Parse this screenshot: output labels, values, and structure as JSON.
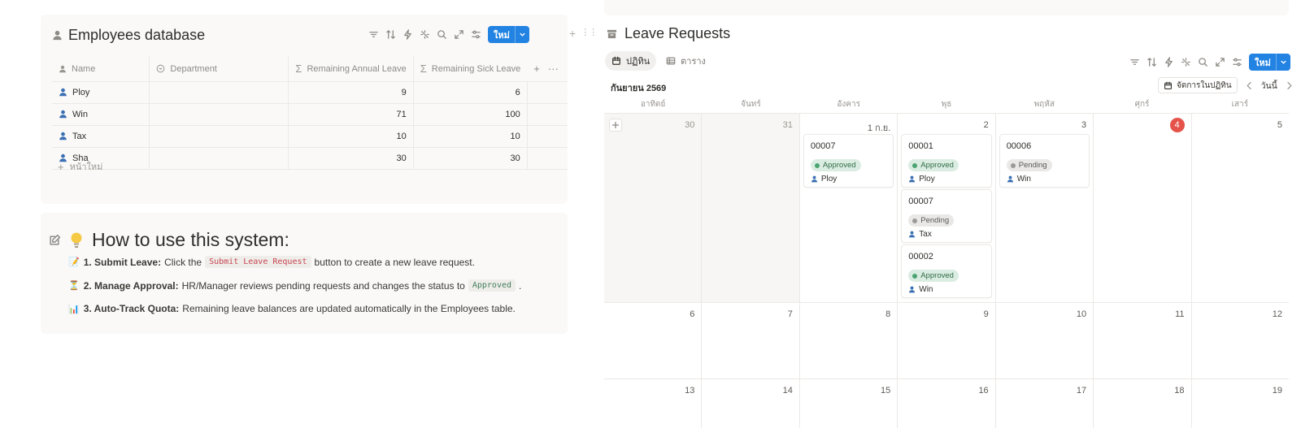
{
  "employees": {
    "title": "Employees database",
    "new_label": "ใหม่",
    "columns": [
      "Name",
      "Department",
      "Remaining Annual Leave",
      "Remaining Sick Leave"
    ],
    "rows": [
      {
        "name": "Ploy",
        "department": "",
        "annual": "9",
        "sick": "6"
      },
      {
        "name": "Win",
        "department": "",
        "annual": "71",
        "sick": "100"
      },
      {
        "name": "Tax",
        "department": "",
        "annual": "10",
        "sick": "10"
      },
      {
        "name": "Sha",
        "department": "",
        "annual": "30",
        "sick": "30"
      }
    ],
    "add_row_label": "หน้าใหม่"
  },
  "how_to": {
    "title": "How to use this system:",
    "steps": [
      {
        "bold": "1. Submit Leave:",
        "pre": "Click the",
        "code": "Submit Leave Request",
        "post": "button to create a new leave request."
      },
      {
        "bold": "2. Manage Approval:",
        "pre": "HR/Manager reviews pending requests and changes the status to",
        "code": "Approved",
        "post": "."
      },
      {
        "bold": "3. Auto-Track Quota:",
        "pre": "Remaining leave balances are updated automatically in the Employees table.",
        "code": "",
        "post": ""
      }
    ]
  },
  "leave": {
    "title": "Leave Requests",
    "tabs": [
      "ปฏิทิน",
      "ตาราง"
    ],
    "new_label": "ใหม่",
    "month": "กันยายน 2569",
    "manage_label": "จัดการในปฏิทิน",
    "today_label": "วันนี้",
    "weekdays": [
      "อาทิตย์",
      "จันทร์",
      "อังคาร",
      "พุธ",
      "พฤหัส",
      "ศุกร์",
      "เสาร์"
    ],
    "week1_days": [
      "30",
      "31",
      "1 ก.ย.",
      "2",
      "3",
      "4",
      "5"
    ],
    "week2_days": [
      "6",
      "7",
      "8",
      "9",
      "10",
      "11",
      "12"
    ],
    "week3_days": [
      "13",
      "14",
      "15",
      "16",
      "17",
      "18",
      "19"
    ],
    "cards": [
      {
        "id": "00007",
        "status": "Approved",
        "person": "Ploy"
      },
      {
        "id": "00001",
        "status": "Approved",
        "person": "Ploy"
      },
      {
        "id": "00007",
        "status": "Pending",
        "person": "Tax"
      },
      {
        "id": "00002",
        "status": "Approved",
        "person": "Win"
      },
      {
        "id": "00006",
        "status": "Pending",
        "person": "Win"
      }
    ]
  },
  "colors": {
    "accent": "#2383e2",
    "today": "#e5534b",
    "approved_bg": "#dbede2",
    "pending_bg": "#e9e8e6"
  }
}
